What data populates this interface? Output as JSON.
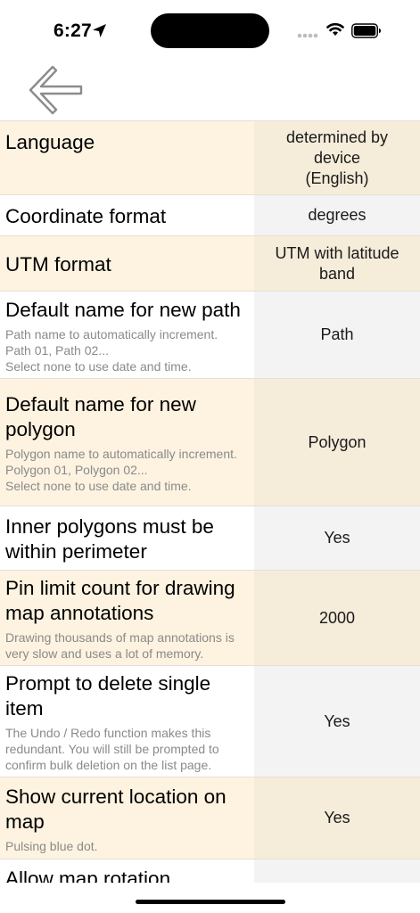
{
  "status_bar": {
    "time": "6:27"
  },
  "settings": {
    "rows": [
      {
        "title": "Language",
        "subtitle": "",
        "value": "determined by\ndevice\n(English)"
      },
      {
        "title": "Coordinate format",
        "subtitle": "",
        "value": "degrees"
      },
      {
        "title": "UTM format",
        "subtitle": "",
        "value": "UTM with latitude\nband"
      },
      {
        "title": "Default name for new path",
        "subtitle": "Path name to automatically increment.\nPath 01, Path 02...\nSelect none to use date and time.",
        "value": "Path"
      },
      {
        "title": "Default name for new polygon",
        "subtitle": "Polygon name to automatically increment.\nPolygon 01, Polygon 02...\nSelect none to use date and time.",
        "value": "Polygon"
      },
      {
        "title": "Inner polygons must be within perimeter",
        "subtitle": "",
        "value": "Yes"
      },
      {
        "title": "Pin limit count for drawing map annotations",
        "subtitle": "Drawing thousands of map annotations is very slow and uses a lot of memory.",
        "value": "2000"
      },
      {
        "title": "Prompt to delete single item",
        "subtitle": "The Undo / Redo function makes this redundant.  You will still be prompted to confirm bulk deletion on the list page.",
        "value": "Yes"
      },
      {
        "title": "Show current location on map",
        "subtitle": "Pulsing blue dot.",
        "value": "Yes"
      },
      {
        "title": "Allow map rotation",
        "subtitle": "",
        "value": ""
      }
    ]
  }
}
